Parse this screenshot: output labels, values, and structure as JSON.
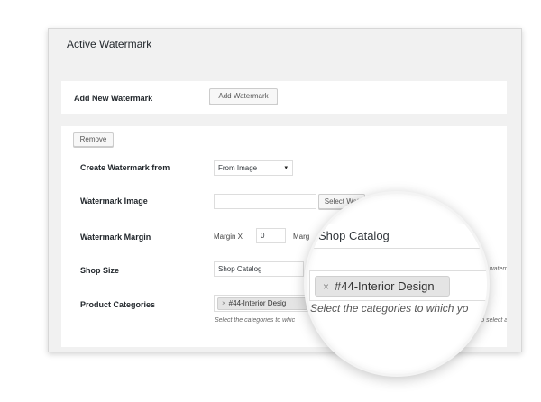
{
  "panel": {
    "title": "Active Watermark"
  },
  "add_section": {
    "label": "Add New Watermark",
    "button": "Add Watermark"
  },
  "form": {
    "remove_button": "Remove",
    "create_from": {
      "label": "Create Watermark from",
      "value": "From Image",
      "arrow": "▾"
    },
    "image": {
      "label": "Watermark Image",
      "value": "",
      "button": "Select Wat"
    },
    "margin": {
      "label": "Watermark Margin",
      "x_label": "Margin X",
      "x_value": "0",
      "y_label": "Marg"
    },
    "shop_size": {
      "label": "Shop Size",
      "value": "Shop Catalog",
      "side_desc": "ply the waterm"
    },
    "categories": {
      "label": "Product Categories",
      "tag": "#44-Interior Desig",
      "tag_remove": "×",
      "desc_left": "Select the categories to whic",
      "desc_right": "pty to select all"
    }
  },
  "magnifier": {
    "shop_size_value": "Shop Catalog",
    "tag": "#44-Interior Design",
    "tag_remove": "×",
    "description": "Select the categories to which yo"
  }
}
